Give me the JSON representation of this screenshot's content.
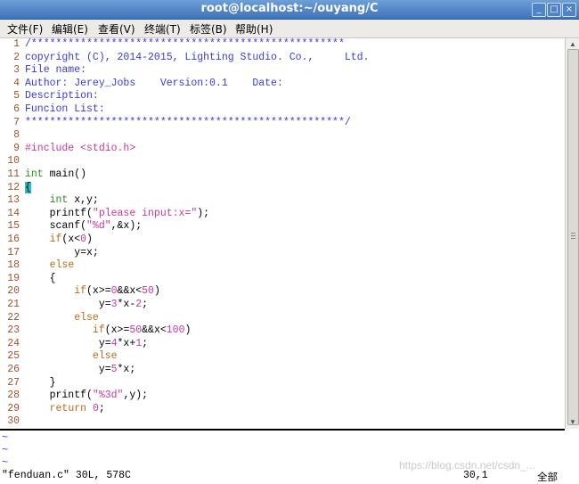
{
  "window": {
    "title": "root@localhost:~/ouyang/C",
    "minimize": "_",
    "maximize": "□",
    "close": "×"
  },
  "menu": [
    "文件(F)",
    "编辑(E)",
    "查看(V)",
    "终端(T)",
    "标签(B)",
    "帮助(H)"
  ],
  "code_lines": [
    {
      "n": "1",
      "segs": [
        {
          "t": "/***************************************************",
          "c": "cmt"
        }
      ]
    },
    {
      "n": "2",
      "segs": [
        {
          "t": "copyright (C), 2014-2015, Lighting Studio. Co.,     Ltd.",
          "c": "cmt"
        }
      ]
    },
    {
      "n": "3",
      "segs": [
        {
          "t": "File name:",
          "c": "cmt"
        }
      ]
    },
    {
      "n": "4",
      "segs": [
        {
          "t": "Author: Jerey_Jobs    Version:0.1    Date:",
          "c": "cmt"
        }
      ]
    },
    {
      "n": "5",
      "segs": [
        {
          "t": "Description:",
          "c": "cmt"
        }
      ]
    },
    {
      "n": "6",
      "segs": [
        {
          "t": "Funcion List:",
          "c": "cmt"
        }
      ]
    },
    {
      "n": "7",
      "segs": [
        {
          "t": "****************************************************/",
          "c": "cmt"
        }
      ]
    },
    {
      "n": "8",
      "segs": []
    },
    {
      "n": "9",
      "segs": [
        {
          "t": "#include ",
          "c": "pre"
        },
        {
          "t": "<stdio.h>",
          "c": "pre"
        }
      ]
    },
    {
      "n": "10",
      "segs": []
    },
    {
      "n": "11",
      "segs": [
        {
          "t": "int",
          "c": "type"
        },
        {
          "t": " main()",
          "c": ""
        }
      ]
    },
    {
      "n": "12",
      "segs": [
        {
          "t": "{",
          "c": "brace"
        }
      ]
    },
    {
      "n": "13",
      "segs": [
        {
          "t": "    ",
          "c": ""
        },
        {
          "t": "int",
          "c": "type"
        },
        {
          "t": " x,y;",
          "c": ""
        }
      ]
    },
    {
      "n": "14",
      "segs": [
        {
          "t": "    printf(",
          "c": ""
        },
        {
          "t": "\"please input:x=\"",
          "c": "str"
        },
        {
          "t": ");",
          "c": ""
        }
      ]
    },
    {
      "n": "15",
      "segs": [
        {
          "t": "    scanf(",
          "c": ""
        },
        {
          "t": "\"%d\"",
          "c": "str"
        },
        {
          "t": ",&x);",
          "c": ""
        }
      ]
    },
    {
      "n": "16",
      "segs": [
        {
          "t": "    ",
          "c": ""
        },
        {
          "t": "if",
          "c": "kw"
        },
        {
          "t": "(x<",
          "c": ""
        },
        {
          "t": "0",
          "c": "num"
        },
        {
          "t": ")",
          "c": ""
        }
      ]
    },
    {
      "n": "17",
      "segs": [
        {
          "t": "        y=x;",
          "c": ""
        }
      ]
    },
    {
      "n": "18",
      "segs": [
        {
          "t": "    ",
          "c": ""
        },
        {
          "t": "else",
          "c": "kw"
        }
      ]
    },
    {
      "n": "19",
      "segs": [
        {
          "t": "    {",
          "c": ""
        }
      ]
    },
    {
      "n": "20",
      "segs": [
        {
          "t": "        ",
          "c": ""
        },
        {
          "t": "if",
          "c": "kw"
        },
        {
          "t": "(x>=",
          "c": ""
        },
        {
          "t": "0",
          "c": "num"
        },
        {
          "t": "&&x<",
          "c": ""
        },
        {
          "t": "50",
          "c": "num"
        },
        {
          "t": ")",
          "c": ""
        }
      ]
    },
    {
      "n": "21",
      "segs": [
        {
          "t": "            y=",
          "c": ""
        },
        {
          "t": "3",
          "c": "num"
        },
        {
          "t": "*x-",
          "c": ""
        },
        {
          "t": "2",
          "c": "num"
        },
        {
          "t": ";",
          "c": ""
        }
      ]
    },
    {
      "n": "22",
      "segs": [
        {
          "t": "        ",
          "c": ""
        },
        {
          "t": "else",
          "c": "kw"
        }
      ]
    },
    {
      "n": "23",
      "segs": [
        {
          "t": "           ",
          "c": ""
        },
        {
          "t": "if",
          "c": "kw"
        },
        {
          "t": "(x>=",
          "c": ""
        },
        {
          "t": "50",
          "c": "num"
        },
        {
          "t": "&&x<",
          "c": ""
        },
        {
          "t": "100",
          "c": "num"
        },
        {
          "t": ")",
          "c": ""
        }
      ]
    },
    {
      "n": "24",
      "segs": [
        {
          "t": "            y=",
          "c": ""
        },
        {
          "t": "4",
          "c": "num"
        },
        {
          "t": "*x+",
          "c": ""
        },
        {
          "t": "1",
          "c": "num"
        },
        {
          "t": ";",
          "c": ""
        }
      ]
    },
    {
      "n": "25",
      "segs": [
        {
          "t": "           ",
          "c": ""
        },
        {
          "t": "else",
          "c": "kw"
        }
      ]
    },
    {
      "n": "26",
      "segs": [
        {
          "t": "            y=",
          "c": ""
        },
        {
          "t": "5",
          "c": "num"
        },
        {
          "t": "*x;",
          "c": ""
        }
      ]
    },
    {
      "n": "27",
      "segs": [
        {
          "t": "    }",
          "c": ""
        }
      ]
    },
    {
      "n": "28",
      "segs": [
        {
          "t": "    printf(",
          "c": ""
        },
        {
          "t": "\"%3d\"",
          "c": "str"
        },
        {
          "t": ",y);",
          "c": ""
        }
      ]
    },
    {
      "n": "29",
      "segs": [
        {
          "t": "    ",
          "c": ""
        },
        {
          "t": "return",
          "c": "kw"
        },
        {
          "t": " ",
          "c": ""
        },
        {
          "t": "0",
          "c": "num"
        },
        {
          "t": ";",
          "c": ""
        }
      ]
    },
    {
      "n": "30",
      "segs": [
        {
          "t": " ",
          "c": "cursor"
        }
      ]
    }
  ],
  "tildes": [
    "~",
    "~",
    "~"
  ],
  "cmdline": {
    "file_info": "\"fenduan.c\" 30L, 578C",
    "position": "30,1",
    "scroll": "全部"
  },
  "watermark": "https://blog.csdn.net/csdn_..."
}
